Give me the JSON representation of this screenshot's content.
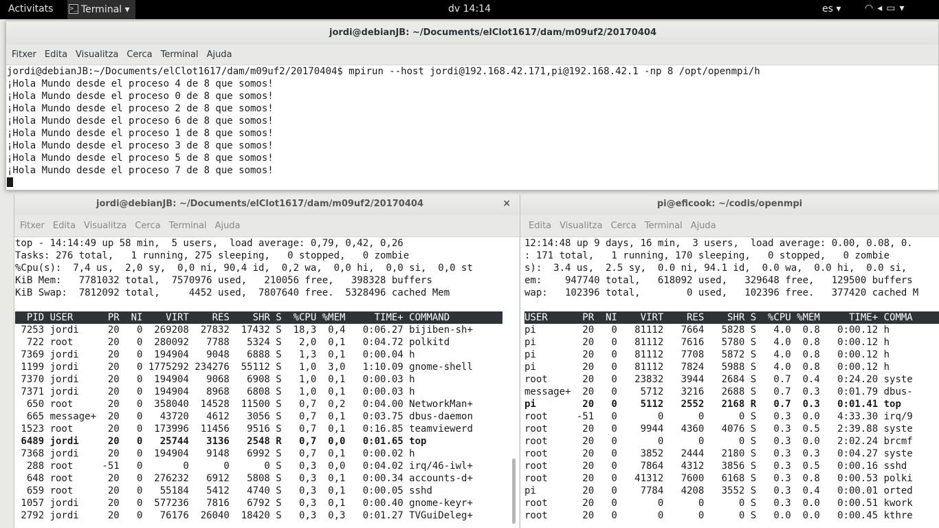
{
  "topbar": {
    "activities": "Activitats",
    "app_menu": "Terminal ▾",
    "clock": "dv 14:14",
    "lang": "es ▾",
    "tray": "▾ 🔊 ▾"
  },
  "windows": {
    "local_mpi": {
      "title": "jordi@debianJB: ~/Documents/elClot1617/dam/m09uf2/20170404",
      "menu": [
        "Fitxer",
        "Edita",
        "Visualitza",
        "Cerca",
        "Terminal",
        "Ajuda"
      ],
      "lines": [
        "jordi@debianJB:~/Documents/elClot1617/dam/m09uf2/20170404$ mpirun --host jordi@192.168.42.171,pi@192.168.42.1 -np 8 /opt/openmpi/h",
        "¡Hola Mundo desde el proceso 4 de 8 que somos!",
        "¡Hola Mundo desde el proceso 0 de 8 que somos!",
        "¡Hola Mundo desde el proceso 2 de 8 que somos!",
        "¡Hola Mundo desde el proceso 6 de 8 que somos!",
        "¡Hola Mundo desde el proceso 1 de 8 que somos!",
        "¡Hola Mundo desde el proceso 3 de 8 que somos!",
        "¡Hola Mundo desde el proceso 5 de 8 que somos!",
        "¡Hola Mundo desde el proceso 7 de 8 que somos!"
      ]
    },
    "local_top": {
      "title": "jordi@debianJB: ~/Documents/elClot1617/dam/m09uf2/20170404",
      "close": "×",
      "menu": [
        "Fitxer",
        "Edita",
        "Visualitza",
        "Cerca",
        "Terminal",
        "Ajuda"
      ],
      "summary": [
        "top - 14:14:49 up 58 min,  5 users,  load average: 0,79, 0,42, 0,26",
        "Tasks: 276 total,   1 running, 275 sleeping,   0 stopped,   0 zombie",
        "%Cpu(s):  7,4 us,  2,0 sy,  0,0 ni, 90,4 id,  0,2 wa,  0,0 hi,  0,0 si,  0,0 st",
        "KiB Mem:   7781032 total,  7570976 used,   210056 free,   398328 buffers",
        "KiB Swap:  7812092 total,     4452 used,  7807640 free.  5328496 cached Mem"
      ],
      "header": "  PID USER      PR  NI    VIRT    RES    SHR S  %CPU %MEM     TIME+ COMMAND     ",
      "rows": [
        " 7253 jordi     20   0  269208  27832  17432 S  18,3  0,4   0:06.27 bijiben-sh+",
        "  722 root      20   0  280092   7788   5324 S   2,0  0,1   0:04.72 polkitd    ",
        " 7369 jordi     20   0  194904   9048   6888 S   1,3  0,1   0:00.04 h          ",
        " 1199 jordi     20   0 1775292 234276  55112 S   1,0  3,0   1:10.09 gnome-shell",
        " 7370 jordi     20   0  194904   9068   6908 S   1,0  0,1   0:00.03 h          ",
        " 7371 jordi     20   0  194904   8968   6808 S   1,0  0,1   0:00.03 h          ",
        "  650 root      20   0  358040  14528  11500 S   0,7  0,2   0:04.00 NetworkMan+",
        "  665 message+  20   0   43720   4612   3056 S   0,7  0,1   0:03.75 dbus-daemon",
        " 1523 root      20   0  173996  11456   9516 S   0,7  0,1   0:16.85 teamviewerd",
        " 6489 jordi     20   0   25744   3136   2548 R   0,7  0,0   0:01.65 top        ",
        " 7368 jordi     20   0  194904   9148   6992 S   0,7  0,1   0:00.02 h          ",
        "  288 root     -51   0       0      0      0 S   0,3  0,0   0:04.02 irq/46-iwl+",
        "  648 root      20   0  276232   6912   5808 S   0,3  0,1   0:00.34 accounts-d+",
        "  659 root      20   0   55184   5412   4740 S   0,3  0,1   0:00.05 sshd       ",
        " 1057 jordi     20   0  577236   7816   6792 S   0,3  0,1   0:00.40 gnome-keyr+",
        " 2792 jordi     20   0   76176  26040  18420 S   0,3  0,3   0:01.27 TVGuiDeleg+"
      ],
      "bold_row_index": 9
    },
    "remote_top": {
      "title": "pi@eficook: ~/codis/openmpi",
      "menu": [
        "Edita",
        "Visualitza",
        "Cerca",
        "Terminal",
        "Ajuda"
      ],
      "summary": [
        "12:14:48 up 9 days, 16 min,  3 users,  load average: 0.00, 0.08, 0.",
        ": 171 total,   1 running, 170 sleeping,   0 stopped,   0 zombie",
        "s):  3.4 us,  2.5 sy,  0.0 ni, 94.1 id,  0.0 wa,  0.0 hi,  0.0 si,",
        "em:    947740 total,   618092 used,   329648 free,   129500 buffers",
        "wap:   102396 total,        0 used,   102396 free.   377420 cached M"
      ],
      "header": "USER      PR  NI    VIRT    RES    SHR S  %CPU %MEM     TIME+ COMMA",
      "rows": [
        "pi        20   0   81112   7664   5828 S   4.0  0.8   0:00.12 h    ",
        "pi        20   0   81112   7616   5780 S   4.0  0.8   0:00.12 h    ",
        "pi        20   0   81112   7708   5872 S   4.0  0.8   0:00.12 h    ",
        "pi        20   0   81112   7824   5988 S   4.0  0.8   0:00.12 h    ",
        "root      20   0   23832   3944   2684 S   0.7  0.4   0:24.20 syste",
        "message+  20   0    5712   3216   2688 S   0.7  0.3   0:01.79 dbus-",
        "pi        20   0    5112   2552   2168 R   0.7  0.3   0:01.41 top  ",
        "root     -51   0       0      0      0 S   0.3  0.0   4:33.30 irq/9",
        "root      20   0    9944   4360   4076 S   0.3  0.5   2:39.88 syste",
        "root      20   0       0      0      0 S   0.3  0.0   2:02.24 brcmf",
        "root      20   0    3852   2444   2180 S   0.3  0.3   0:04.27 syste",
        "root      20   0    7864   4312   3856 S   0.3  0.5   0:00.16 sshd ",
        "root      20   0   41312   7600   6168 S   0.3  0.8   0:00.53 polki",
        "pi        20   0    7784   4208   3552 S   0.3  0.4   0:00.01 orted",
        "root      20   0       0      0      0 S   0.3  0.0   0:00.51 kwork",
        "root      20   0       0      0      0 S   0.0  0.0   0:00.45 kthre"
      ],
      "bold_row_index": 6
    }
  }
}
